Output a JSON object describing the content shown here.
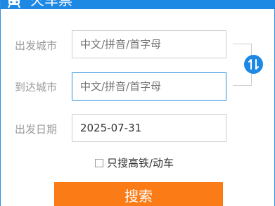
{
  "header": {
    "title": "火车票",
    "icon": "train-icon"
  },
  "form": {
    "departure": {
      "label": "出发城市",
      "placeholder": "中文/拼音/首字母"
    },
    "arrival": {
      "label": "到达城市",
      "placeholder": "中文/拼音/首字母"
    },
    "date": {
      "label": "出发日期",
      "value": "2025-07-31"
    },
    "swap_icon": "swap-arrows-icon",
    "high_speed_only": {
      "label": "只搜高铁/动车",
      "checked": false
    },
    "search_label": "搜索"
  },
  "colors": {
    "accent": "#1e88e5",
    "search_button": "#fb7b16",
    "label_text": "#9a9a9a",
    "placeholder_text": "#8e8e8e"
  }
}
